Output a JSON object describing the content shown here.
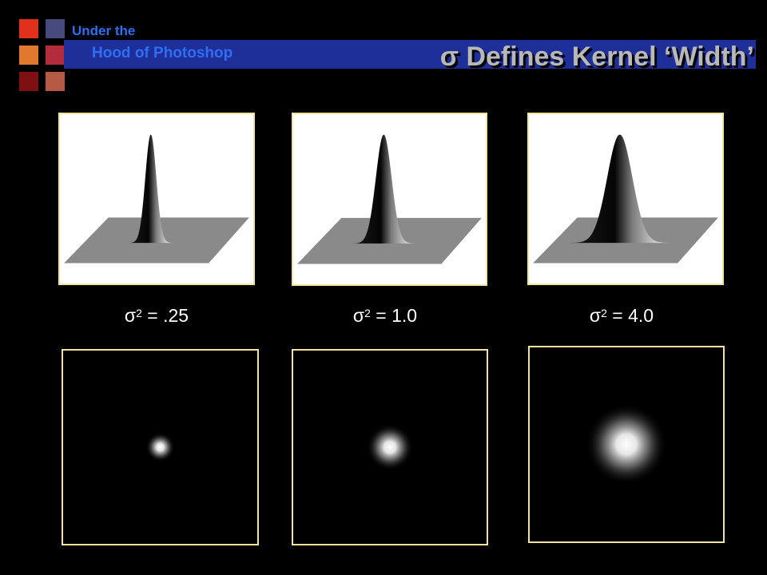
{
  "header": {
    "brand_line1": "Under the",
    "brand_line2": "Hood of Photoshop",
    "title": "σ Defines Kernel ‘Width’"
  },
  "colors": {
    "accent_blue": "#2f6df2",
    "title_bar": "#1f2f9a",
    "panel_border": "#f1e4a0",
    "logo": [
      "#e0311c",
      "#484a7d",
      "#e0792e",
      "#b32b3d",
      "#7e0f13",
      "#b65a46"
    ]
  },
  "kernels": [
    {
      "sigma_squared": 0.25,
      "caption_symbol": "σ",
      "caption_exp": "2",
      "caption_value": " = .25"
    },
    {
      "sigma_squared": 1.0,
      "caption_symbol": "σ",
      "caption_exp": "2",
      "caption_value": " = 1.0"
    },
    {
      "sigma_squared": 4.0,
      "caption_symbol": "σ",
      "caption_exp": "2",
      "caption_value": " = 4.0"
    }
  ]
}
